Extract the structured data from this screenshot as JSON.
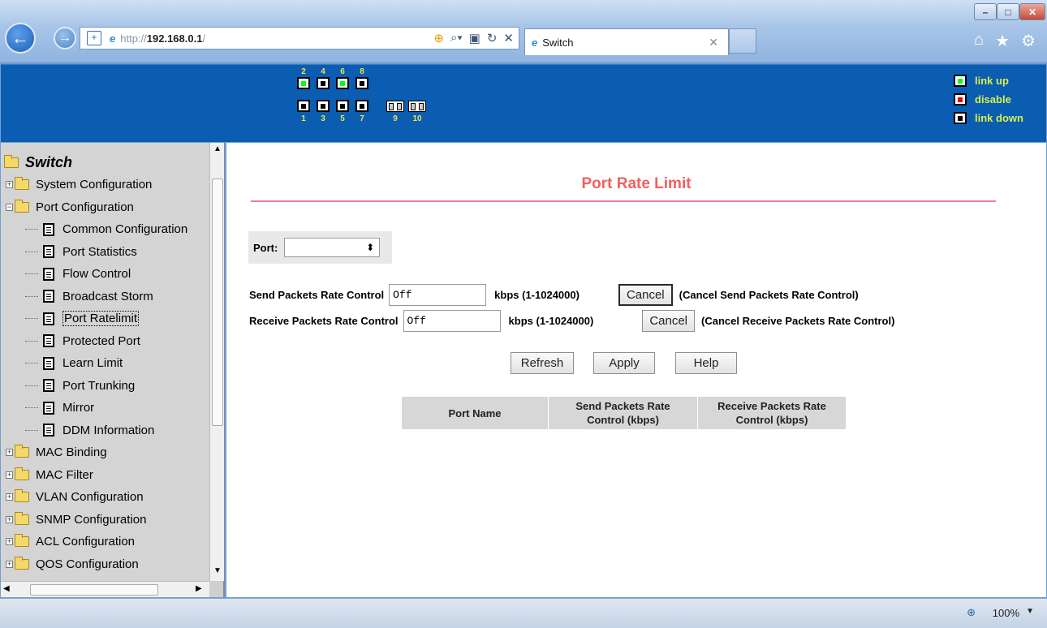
{
  "browser": {
    "url_proto": "http://",
    "url_host": "192.168.0.1",
    "url_tail": "/",
    "tab_title": "Switch",
    "zoom": "100%"
  },
  "switch_panel": {
    "top_port_numbers": [
      "2",
      "4",
      "6",
      "8"
    ],
    "bottom_port_numbers": [
      "1",
      "3",
      "5",
      "7"
    ],
    "fiber_port_numbers": [
      "9",
      "10"
    ],
    "top_ports_state": [
      "link up",
      "link down",
      "link up",
      "link down"
    ],
    "bottom_ports_state": [
      "link down",
      "link down",
      "link down",
      "link down"
    ],
    "legend": {
      "link_up": "link up",
      "disable": "disable",
      "link_down": "link down"
    }
  },
  "tree": {
    "root": "Switch",
    "items": [
      {
        "label": "System Configuration",
        "type": "folder",
        "expanded": false
      },
      {
        "label": "Port Configuration",
        "type": "folder",
        "expanded": true
      },
      {
        "label": "Common Configuration",
        "type": "leaf"
      },
      {
        "label": "Port Statistics",
        "type": "leaf"
      },
      {
        "label": "Flow Control",
        "type": "leaf"
      },
      {
        "label": "Broadcast Storm",
        "type": "leaf"
      },
      {
        "label": "Port Ratelimit",
        "type": "leaf",
        "selected": true
      },
      {
        "label": "Protected Port",
        "type": "leaf"
      },
      {
        "label": "Learn Limit",
        "type": "leaf"
      },
      {
        "label": "Port Trunking",
        "type": "leaf"
      },
      {
        "label": "Mirror",
        "type": "leaf"
      },
      {
        "label": "DDM Information",
        "type": "leaf"
      },
      {
        "label": "MAC Binding",
        "type": "folder",
        "expanded": false
      },
      {
        "label": "MAC Filter",
        "type": "folder",
        "expanded": false
      },
      {
        "label": "VLAN Configuration",
        "type": "folder",
        "expanded": false
      },
      {
        "label": "SNMP Configuration",
        "type": "folder",
        "expanded": false
      },
      {
        "label": "ACL Configuration",
        "type": "folder",
        "expanded": false
      },
      {
        "label": "QOS Configuration",
        "type": "folder",
        "expanded": false
      }
    ]
  },
  "main": {
    "title": "Port Rate Limit",
    "port_label": "Port:",
    "port_value": "",
    "send_label": "Send Packets Rate Control",
    "send_value": "Off",
    "send_unit": "kbps (1-1024000)",
    "send_cancel": "Cancel",
    "send_cancel_note": "(Cancel Send Packets Rate Control)",
    "recv_label": "Receive Packets Rate Control",
    "recv_value": "Off",
    "recv_unit": "kbps (1-1024000)",
    "recv_cancel": "Cancel",
    "recv_cancel_note": "(Cancel Receive Packets Rate Control)",
    "refresh": "Refresh",
    "apply": "Apply",
    "help": "Help",
    "table_headers": [
      "Port Name",
      [
        "Send Packets Rate",
        "Control (kbps)"
      ],
      [
        "Receive Packets Rate",
        "Control (kbps)"
      ]
    ]
  }
}
